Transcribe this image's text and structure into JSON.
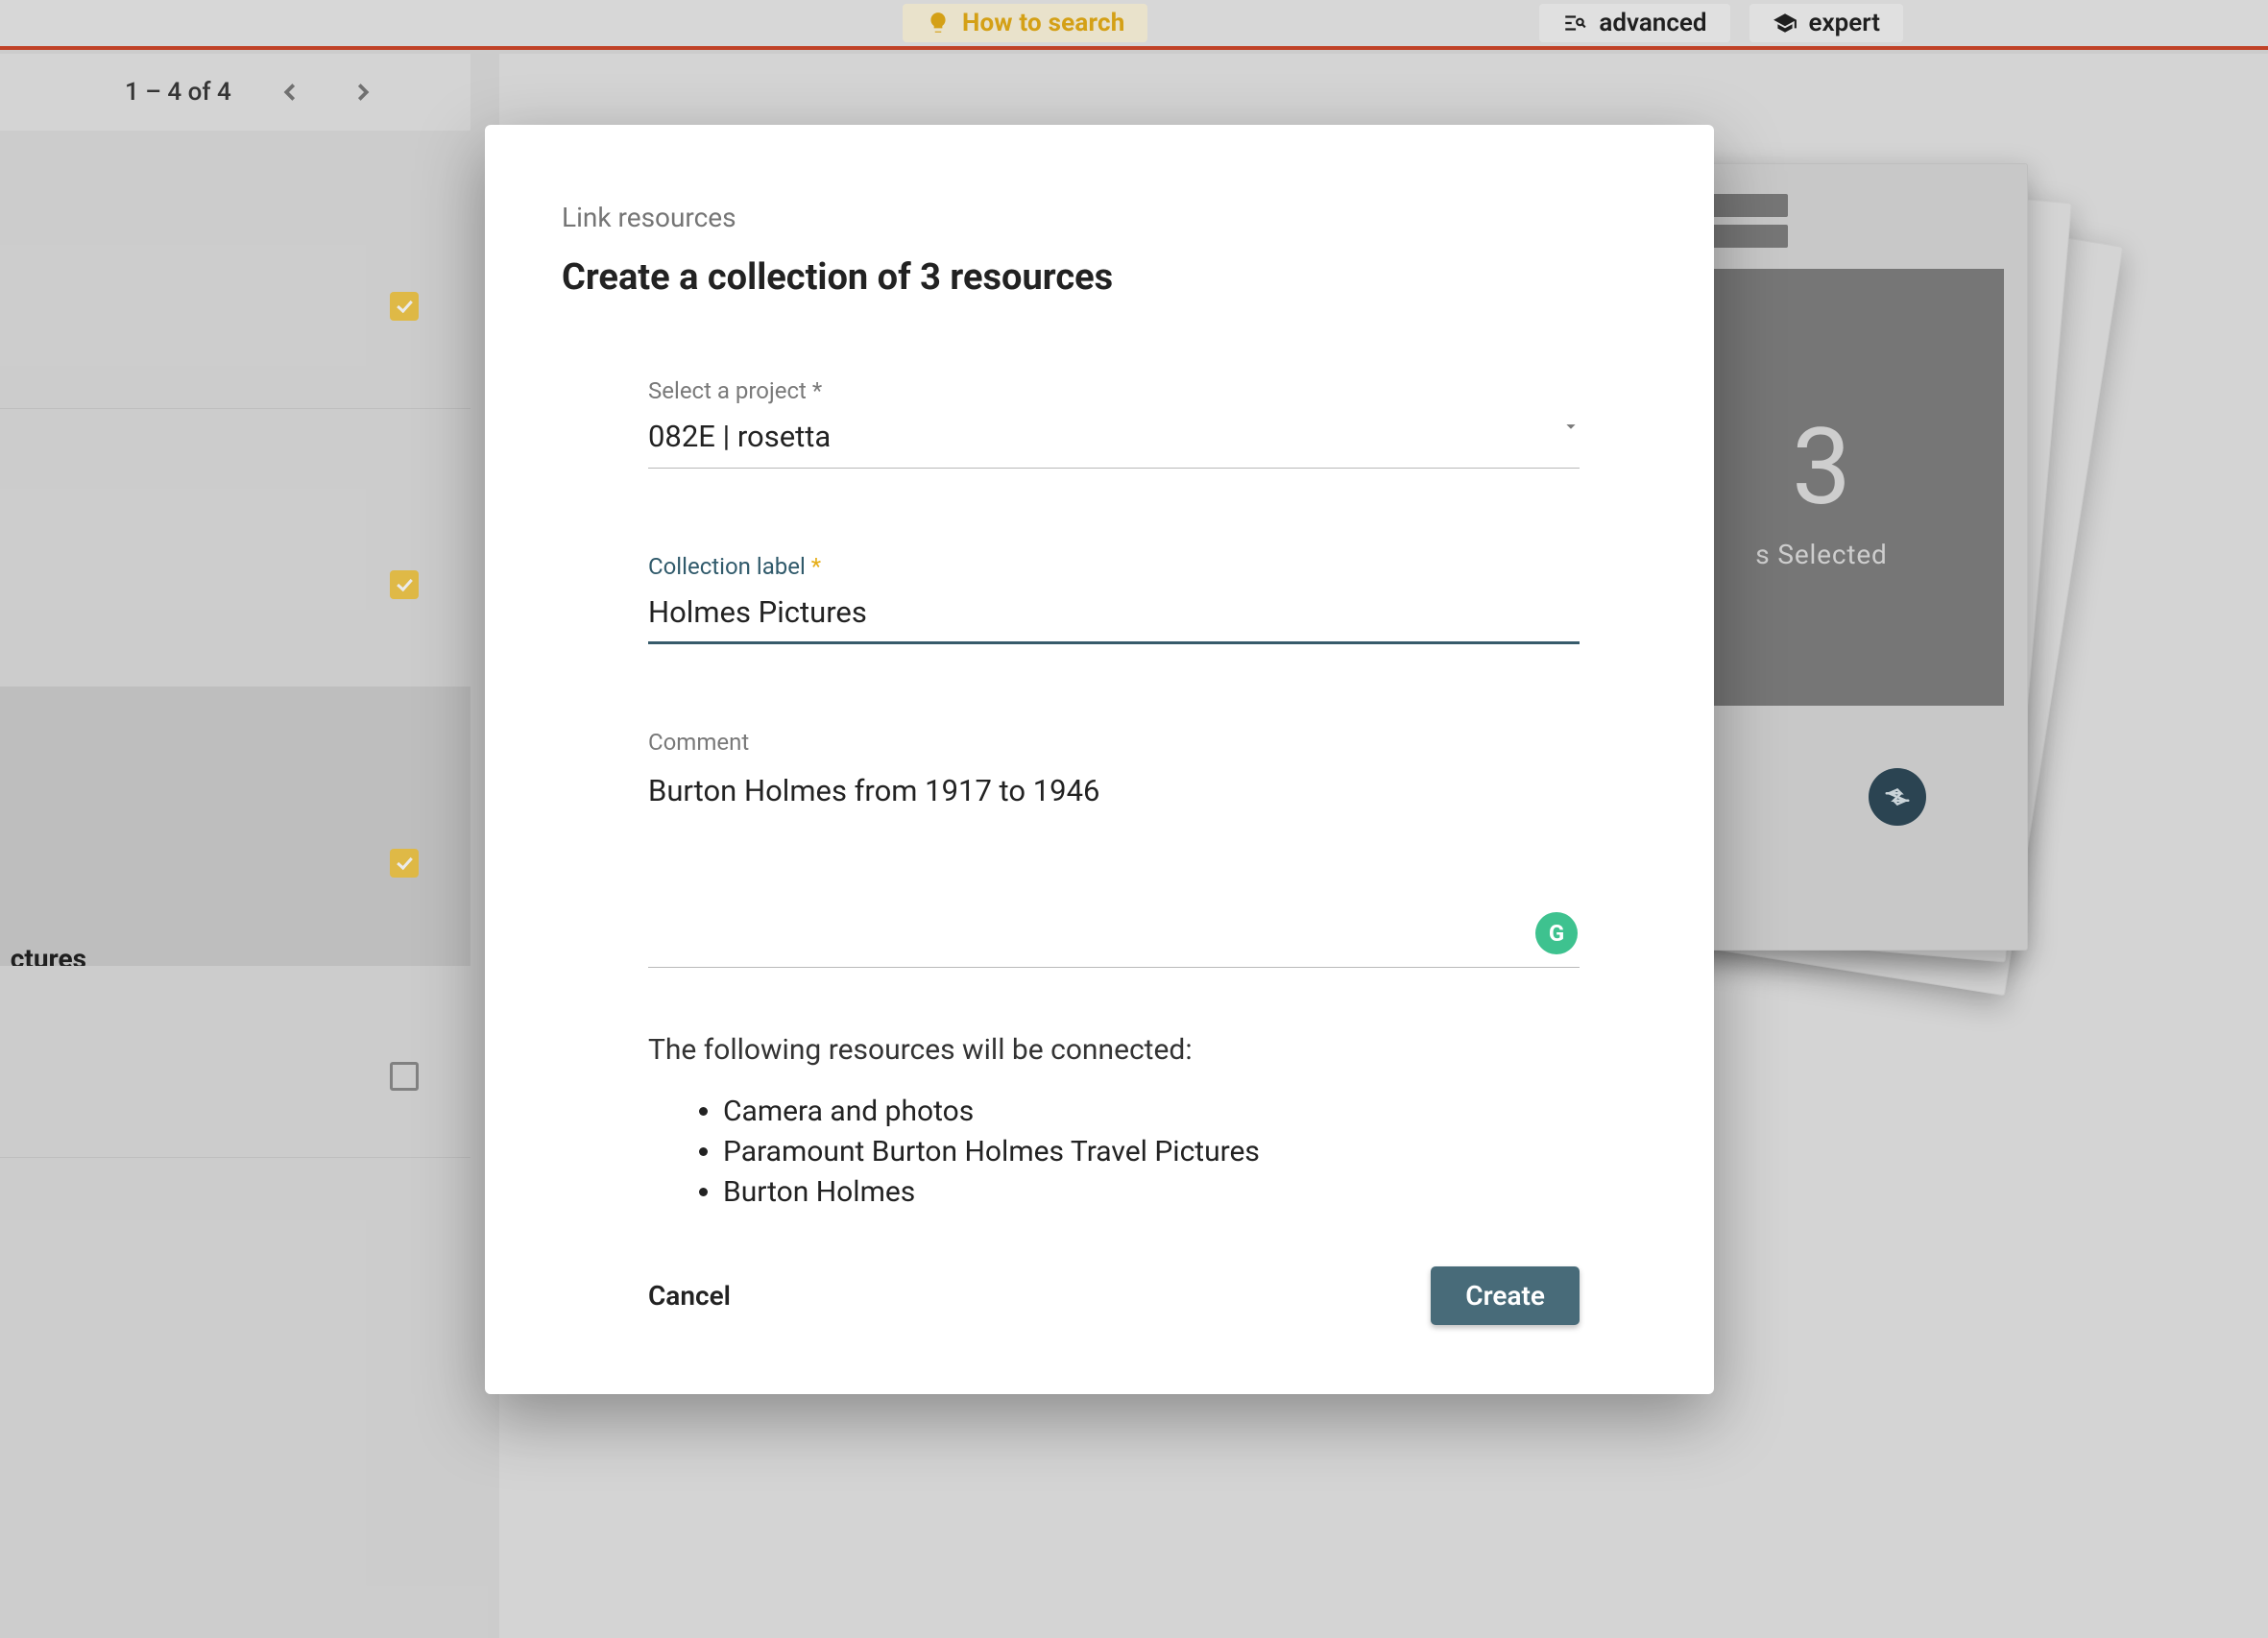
{
  "topbar": {
    "howto_label": "How to search",
    "advanced_label": "advanced",
    "expert_label": "expert"
  },
  "pager": {
    "text": "1 – 4 of 4"
  },
  "left_rows": {
    "r3_label": "ctures"
  },
  "selection": {
    "count": "3",
    "text": "s Selected"
  },
  "modal": {
    "eyebrow": "Link resources",
    "title": "Create a collection of 3 resources",
    "project_label": "Select a project *",
    "project_value": "082E | rosetta",
    "collection_label_text": "Collection label ",
    "collection_value": "Holmes Pictures",
    "comment_label": "Comment",
    "comment_value": "Burton Holmes from 1917 to 1946",
    "connected_text": "The following resources will be connected:",
    "resources": {
      "0": "Camera and photos",
      "1": "Paramount Burton Holmes Travel Pictures",
      "2": "Burton Holmes"
    },
    "cancel_label": "Cancel",
    "create_label": "Create"
  },
  "grammarly": "G"
}
